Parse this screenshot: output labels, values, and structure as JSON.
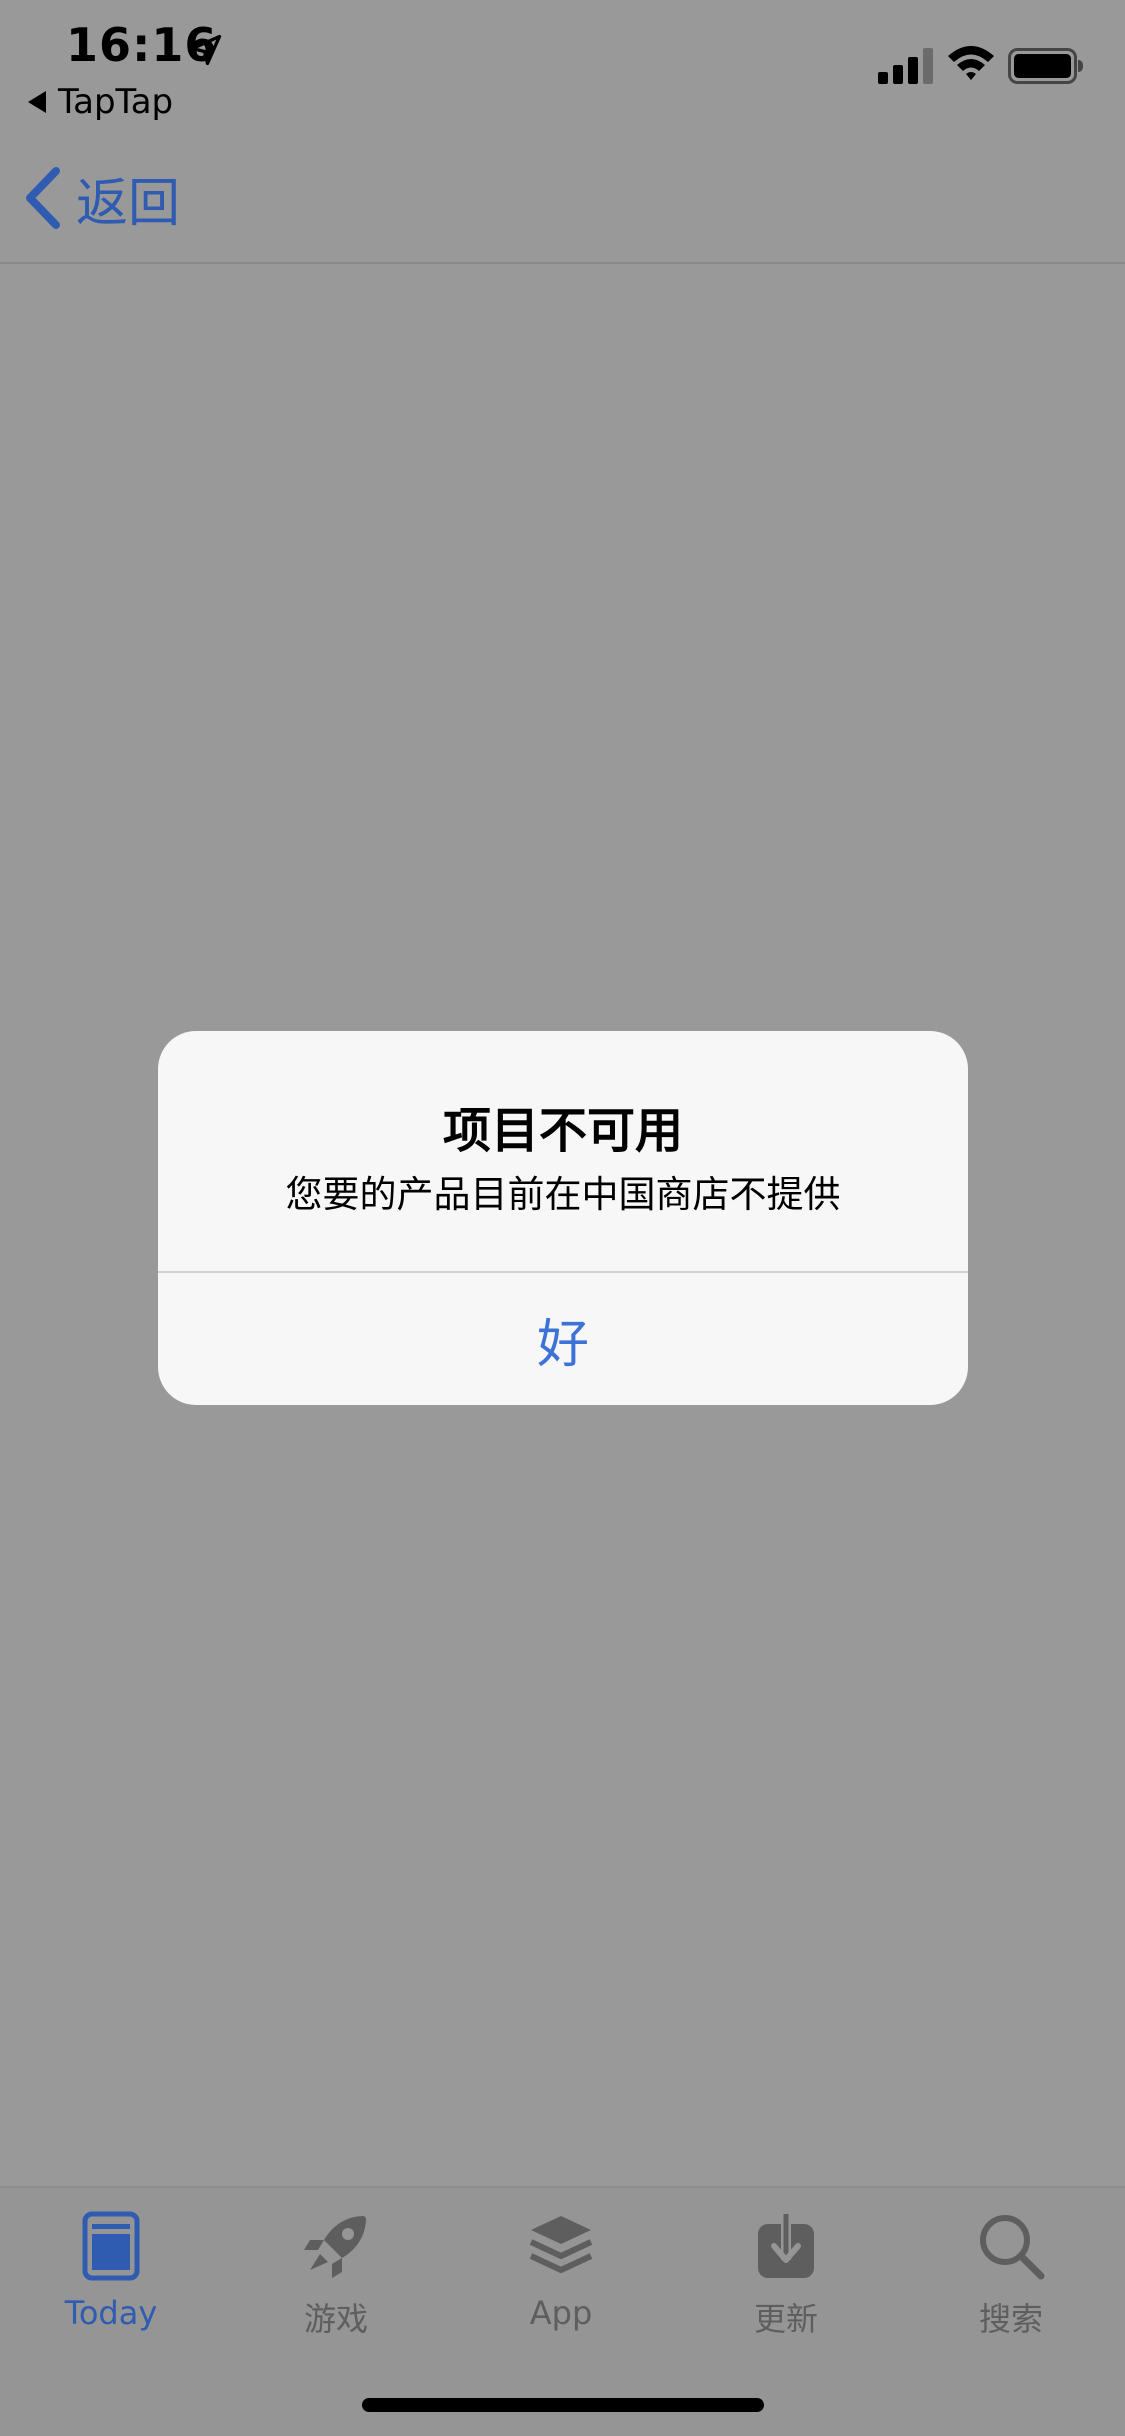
{
  "status_bar": {
    "time": "16:16",
    "back_app_label": "TapTap",
    "icons": [
      "location-arrow-icon",
      "cellular-signal-icon",
      "wifi-icon",
      "battery-icon"
    ]
  },
  "nav": {
    "back_label": "返回",
    "icon": "chevron-left-icon"
  },
  "alert": {
    "title": "项目不可用",
    "message": "您要的产品目前在中国商店不提供",
    "ok_label": "好"
  },
  "tabs": [
    {
      "label": "Today",
      "icon": "today-icon",
      "active": true
    },
    {
      "label": "游戏",
      "icon": "rocket-icon",
      "active": false
    },
    {
      "label": "App",
      "icon": "layers-icon",
      "active": false
    },
    {
      "label": "更新",
      "icon": "download-icon",
      "active": false
    },
    {
      "label": "搜索",
      "icon": "search-icon",
      "active": false
    }
  ],
  "colors": {
    "dimmed_background": "#999999",
    "accent_blue": "#2f5bb0",
    "alert_button_blue": "#3d72d6",
    "alert_background": "#f7f7f7",
    "inactive_tab": "#5e5e5e"
  }
}
